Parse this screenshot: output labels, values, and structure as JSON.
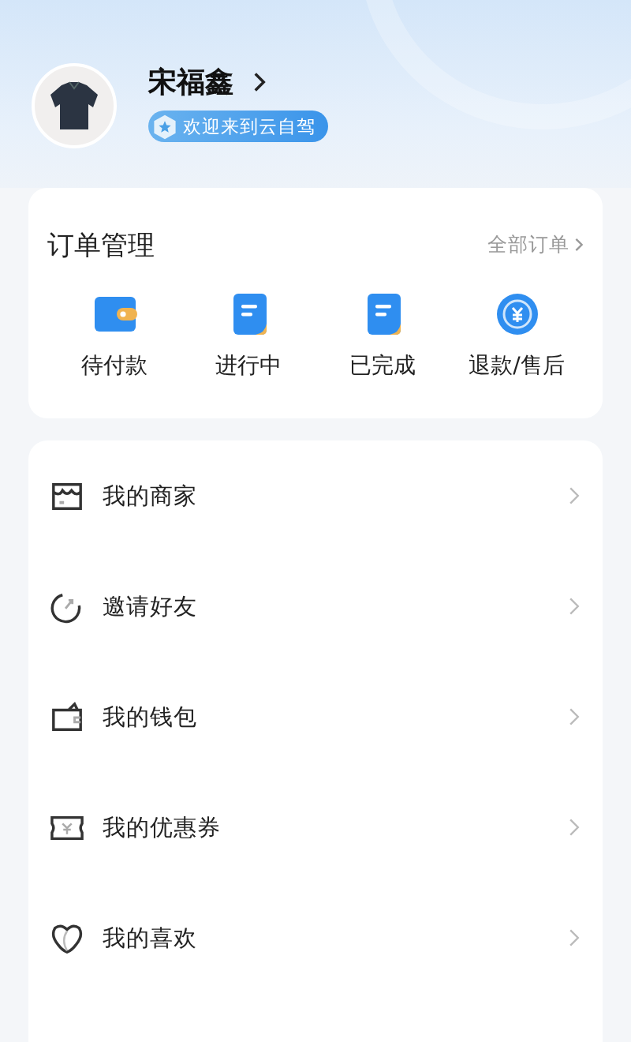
{
  "profile": {
    "name": "宋福鑫",
    "badge": "欢迎来到云自驾"
  },
  "orders": {
    "title": "订单管理",
    "link": "全部订单",
    "items": [
      {
        "kind": "wallet",
        "label": "待付款"
      },
      {
        "kind": "doc",
        "label": "进行中"
      },
      {
        "kind": "doc",
        "label": "已完成"
      },
      {
        "kind": "refund",
        "label": "退款/售后"
      }
    ]
  },
  "menu": [
    {
      "kind": "store",
      "label": "我的商家"
    },
    {
      "kind": "share",
      "label": "邀请好友"
    },
    {
      "kind": "wallet",
      "label": "我的钱包"
    },
    {
      "kind": "coupon",
      "label": "我的优惠券"
    },
    {
      "kind": "heart",
      "label": "我的喜欢"
    }
  ]
}
